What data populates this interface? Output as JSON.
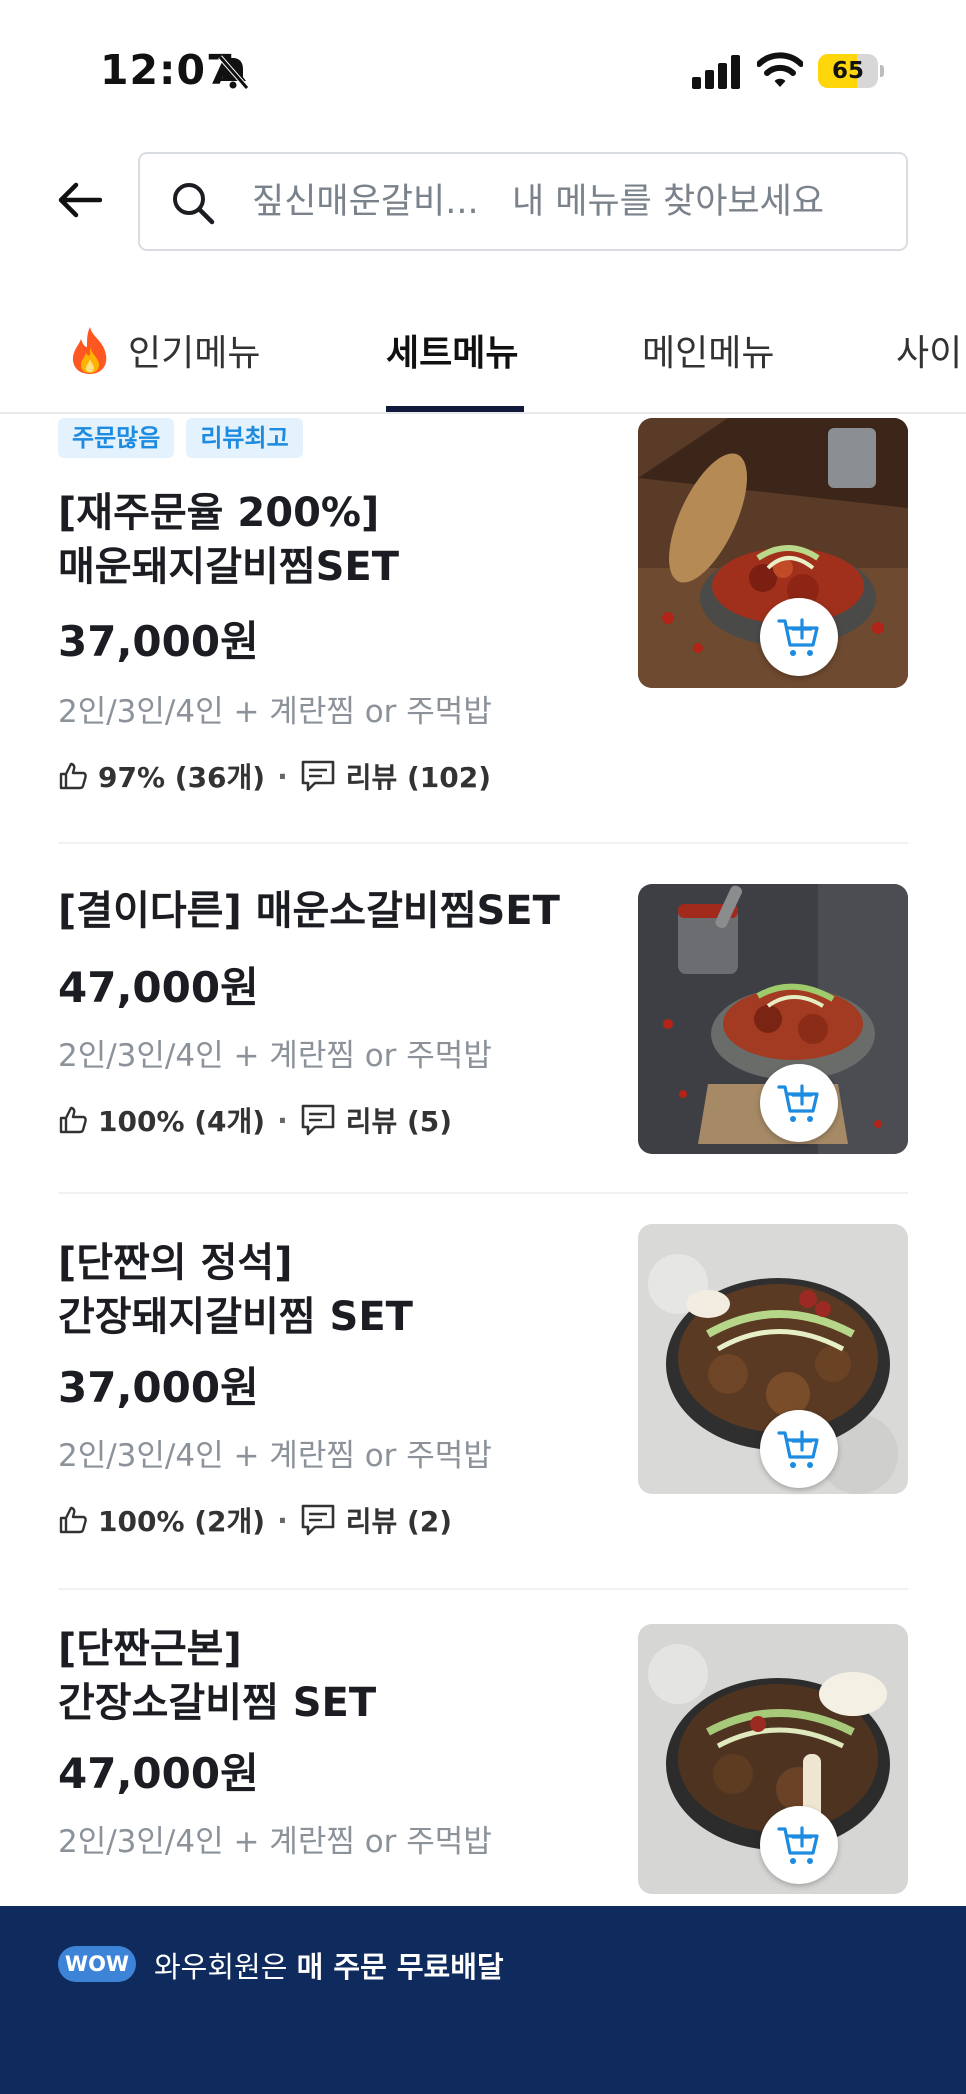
{
  "status_bar": {
    "time": "12:07",
    "battery": "65",
    "battery_level": 0.65,
    "battery_color": "#ffd60a"
  },
  "search": {
    "placeholder": "짚신매운갈비...   내 메뉴를 찾아보세요"
  },
  "tabs": [
    {
      "label": "인기메뉴",
      "icon": "fire-icon",
      "active": false
    },
    {
      "label": "세트메뉴",
      "active": true
    },
    {
      "label": "메인메뉴",
      "active": false
    },
    {
      "label": "사이",
      "active": false
    }
  ],
  "menu_items": [
    {
      "badges": [
        "주문많음",
        "리뷰최고"
      ],
      "title": "[재주문율 200%]\n매운돼지갈비찜SET",
      "price": "37,000원",
      "description": "2인/3인/4인 + 계란찜 or 주먹밥",
      "like_rate": "97% (36개)",
      "reviews": "리뷰 (102)"
    },
    {
      "title": "[결이다른] 매운소갈비찜SET",
      "price": "47,000원",
      "description": "2인/3인/4인 + 계란찜 or 주먹밥",
      "like_rate": "100% (4개)",
      "reviews": "리뷰 (5)"
    },
    {
      "title": "[단짠의 정석]\n간장돼지갈비찜 SET",
      "price": "37,000원",
      "description": "2인/3인/4인 + 계란찜 or 주먹밥",
      "like_rate": "100% (2개)",
      "reviews": "리뷰 (2)"
    },
    {
      "title": " [단짠근본]\n간장소갈비찜 SET",
      "price": "47,000원",
      "description": "2인/3인/4인 + 계란찜 or 주먹밥"
    }
  ],
  "banner": {
    "wow": "WOW",
    "text_prefix": "와우회원은 ",
    "text_bold": "매 주문 무료배달"
  },
  "colors": {
    "accent": "#1c8be0",
    "banner_bg": "#0f2a5c",
    "badge_bg": "#e3f2fd"
  }
}
